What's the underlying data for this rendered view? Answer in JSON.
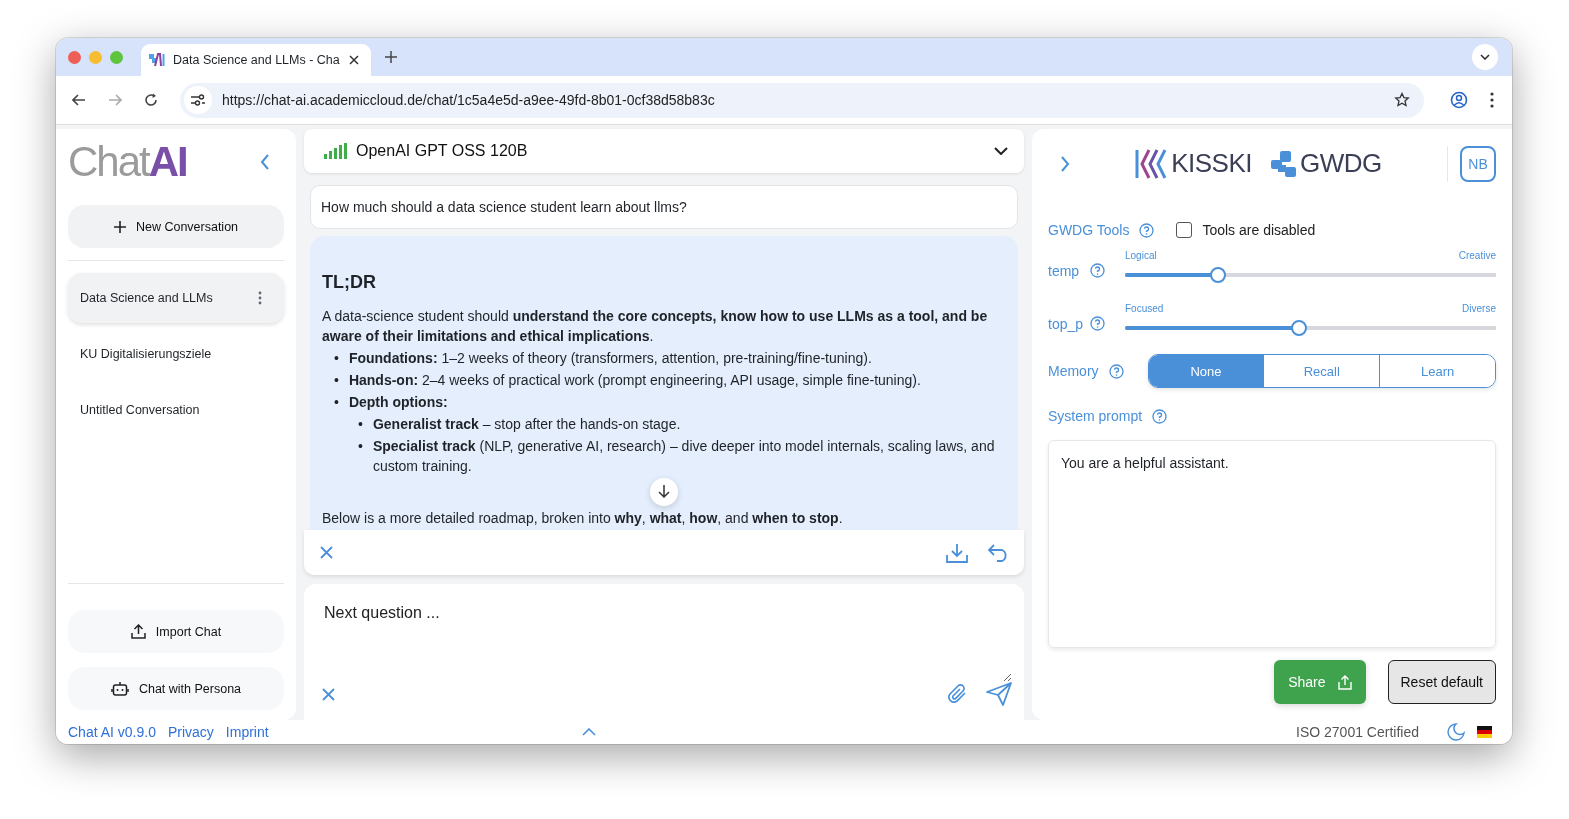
{
  "browser": {
    "tab_title": "Data Science and LLMs - Cha",
    "url": "https://chat-ai.academiccloud.de/chat/1c5a4e5d-a9ee-49fd-8b01-0cf38d58b83c"
  },
  "sidebar": {
    "logo_text": "Chat",
    "logo_mark": "AI",
    "new_button": "New Conversation",
    "conversations": [
      {
        "title": "Data Science and LLMs",
        "selected": true
      },
      {
        "title": "KU Digitalisierungsziele",
        "selected": false
      },
      {
        "title": "Untitled Conversation",
        "selected": false
      }
    ],
    "import_button": "Import Chat",
    "persona_button": "Chat with Persona"
  },
  "chat": {
    "model": "OpenAI GPT OSS 120B",
    "user_message": "How much should a data science student learn about llms?",
    "answer": {
      "heading": "TL;DR",
      "intro": "A data-science student should **understand the core concepts, know how to use LLMs as a tool, and be aware of their limitations and ethical implications**.",
      "bullets": [
        {
          "marker": "•",
          "text": "**Foundations:** 1–2 weeks of theory (transformers, attention, pre-training/fine-tuning)."
        },
        {
          "marker": "•",
          "text": "**Hands-on:** 2–4 weeks of practical work (prompt engineering, API usage, simple fine-tuning)."
        },
        {
          "marker": "•",
          "text": "**Depth options:**",
          "children": [
            {
              "marker": "•",
              "text": "**Generalist track** – stop after the hands-on stage."
            },
            {
              "marker": "•",
              "text": "**Specialist track** (NLP, generative AI, research) – dive deeper into model internals, scaling laws, and custom training."
            }
          ]
        }
      ],
      "outro": "Below is a more detailed roadmap, broken into **why**, **what**, **how**, and **when to stop**."
    },
    "input_placeholder": "Next question ..."
  },
  "settings": {
    "logos": [
      "KISSKI",
      "GWDG"
    ],
    "avatar": "NB",
    "tools_label": "GWDG Tools",
    "tools_checkbox": {
      "label": "Tools are disabled",
      "checked": false
    },
    "sliders": [
      {
        "label": "temp",
        "min_label": "Logical",
        "max_label": "Creative",
        "level": 0.25
      },
      {
        "label": "top_p",
        "min_label": "Focused",
        "max_label": "Diverse",
        "level": 0.47
      }
    ],
    "memory_label": "Memory",
    "memory_options": [
      {
        "label": "None",
        "selected": true
      },
      {
        "label": "Recall",
        "selected": false
      },
      {
        "label": "Learn",
        "selected": false
      }
    ],
    "system_prompt_label": "System prompt",
    "system_prompt": "You are a helpful assistant.",
    "share_button": "Share",
    "reset_button": "Reset default"
  },
  "footer": {
    "links": [
      "Chat AI v0.9.0",
      "Privacy",
      "Imprint"
    ],
    "certification": "ISO 27001 Certified"
  }
}
